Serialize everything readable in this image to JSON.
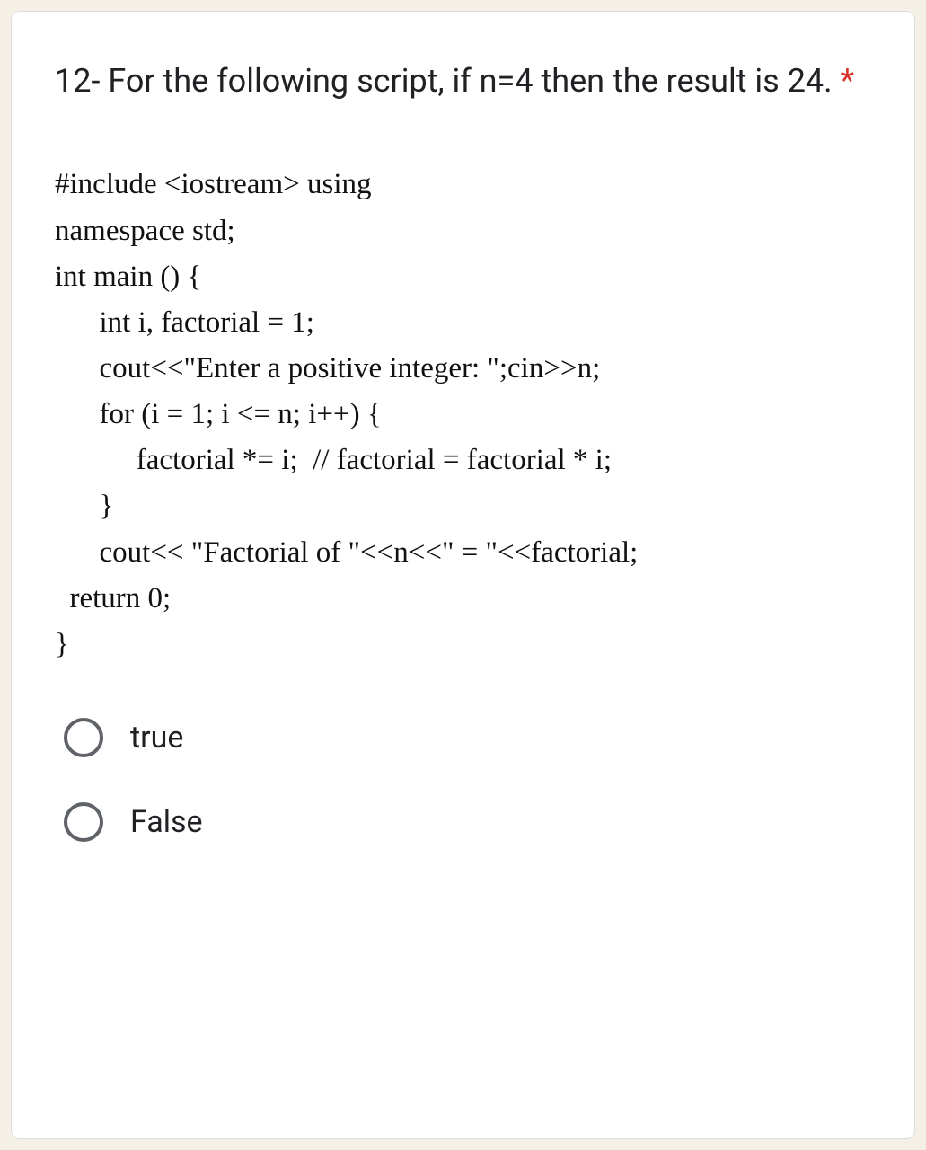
{
  "question": {
    "title": "12- For the following script, if n=4 then the result is 24. ",
    "required_marker": "*"
  },
  "code": {
    "l1": "#include <iostream> using",
    "l2": "namespace std;",
    "l3": "",
    "l4": "int main () {",
    "l5": "      int i, factorial = 1;",
    "l6": "",
    "l7": "      cout<<\"Enter a positive integer: \";cin>>n;",
    "l8": "",
    "l9": "      for (i = 1; i <= n; i++) {",
    "l10": "           factorial *= i;  // factorial = factorial * i;",
    "l11": "      }",
    "l12": "      cout<< \"Factorial of \"<<n<<\" = \"<<factorial;",
    "l13": "",
    "l14": "  return 0;",
    "l15": "}"
  },
  "options": {
    "a": "true",
    "b": "False"
  }
}
